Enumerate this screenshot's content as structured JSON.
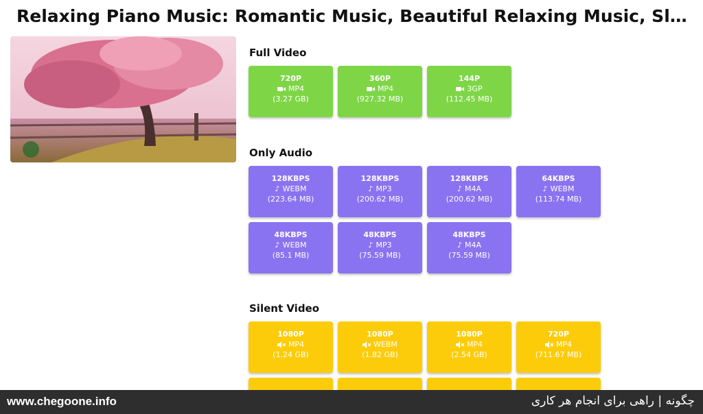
{
  "page": {
    "title": "Relaxing Piano Music: Romantic Music, Beautiful Relaxing Music, Sleep Musi..."
  },
  "sections": {
    "full_video": {
      "title": "Full Video",
      "items": [
        {
          "quality": "720P",
          "format": "MP4",
          "size": "(3.27 GB)",
          "icon": "video-camera-icon"
        },
        {
          "quality": "360P",
          "format": "MP4",
          "size": "(927.32 MB)",
          "icon": "video-camera-icon"
        },
        {
          "quality": "144P",
          "format": "3GP",
          "size": "(112.45 MB)",
          "icon": "video-camera-icon"
        }
      ]
    },
    "only_audio": {
      "title": "Only Audio",
      "items": [
        {
          "quality": "128KBPS",
          "format": "WEBM",
          "size": "(223.64 MB)",
          "icon": "music-note-icon"
        },
        {
          "quality": "128KBPS",
          "format": "MP3",
          "size": "(200.62 MB)",
          "icon": "music-note-icon"
        },
        {
          "quality": "128KBPS",
          "format": "M4A",
          "size": "(200.62 MB)",
          "icon": "music-note-icon"
        },
        {
          "quality": "64KBPS",
          "format": "WEBM",
          "size": "(113.74 MB)",
          "icon": "music-note-icon"
        },
        {
          "quality": "48KBPS",
          "format": "WEBM",
          "size": "(85.1 MB)",
          "icon": "music-note-icon"
        },
        {
          "quality": "48KBPS",
          "format": "MP3",
          "size": "(75.59 MB)",
          "icon": "music-note-icon"
        },
        {
          "quality": "48KBPS",
          "format": "M4A",
          "size": "(75.59 MB)",
          "icon": "music-note-icon"
        }
      ]
    },
    "silent_video": {
      "title": "Silent Video",
      "items": [
        {
          "quality": "1080P",
          "format": "MP4",
          "size": "(1.24 GB)",
          "icon": "muted-speaker-icon"
        },
        {
          "quality": "1080P",
          "format": "WEBM",
          "size": "(1.82 GB)",
          "icon": "muted-speaker-icon"
        },
        {
          "quality": "1080P",
          "format": "MP4",
          "size": "(2.54 GB)",
          "icon": "muted-speaker-icon"
        },
        {
          "quality": "720P",
          "format": "MP4",
          "size": "(711.67 MB)",
          "icon": "muted-speaker-icon"
        }
      ]
    }
  },
  "colors": {
    "full_video": "#7ed647",
    "only_audio": "#8a73f0",
    "silent_video": "#fccc0a"
  },
  "footer": {
    "site": "www.chegoone.info",
    "tagline": "چگونه | راهی برای انجام هر کاری"
  }
}
